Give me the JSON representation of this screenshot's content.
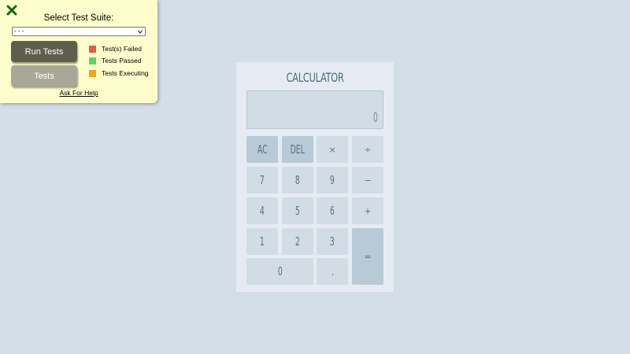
{
  "test_panel": {
    "suite_label": "Select Test Suite:",
    "suite_selected": "- - -",
    "run_tests_label": "Run Tests",
    "tests_label": "Tests",
    "legend": [
      {
        "label": "Test(s) Failed",
        "color": "#e85847"
      },
      {
        "label": "Tests Passed",
        "color": "#63d363"
      },
      {
        "label": "Tests Executing",
        "color": "#f6a21b"
      }
    ],
    "help_link": "Ask For Help",
    "close_icon": "close-x-icon",
    "close_color": "#0a6d0a"
  },
  "calculator": {
    "title": "CALCULATOR",
    "display": "0",
    "keys": {
      "ac": "AC",
      "del": "DEL",
      "multiply": "×",
      "divide": "÷",
      "seven": "7",
      "eight": "8",
      "nine": "9",
      "minus": "−",
      "four": "4",
      "five": "5",
      "six": "6",
      "plus": "+",
      "one": "1",
      "two": "2",
      "three": "3",
      "equals": "=",
      "zero": "0",
      "decimal": "."
    }
  }
}
